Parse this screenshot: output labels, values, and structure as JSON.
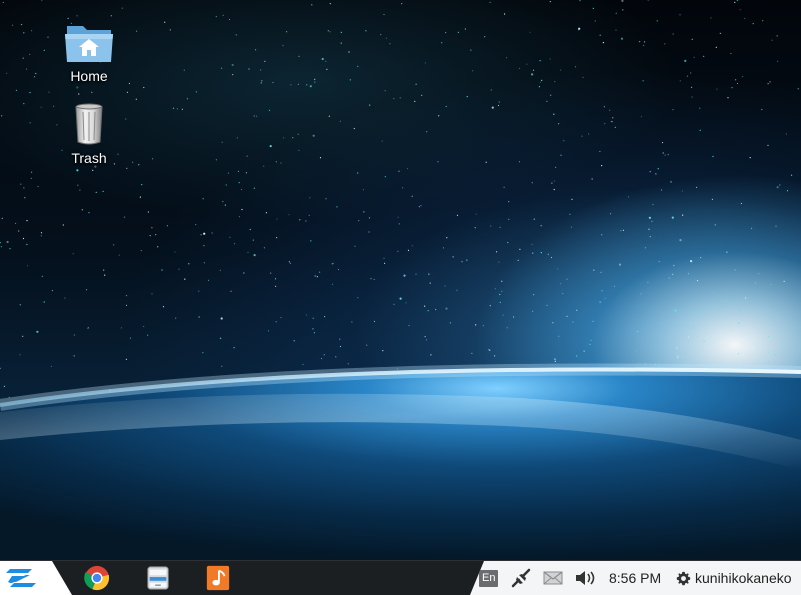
{
  "desktop": {
    "icons": [
      {
        "label": "Home",
        "icon": "home-folder-icon"
      },
      {
        "label": "Trash",
        "icon": "trash-icon"
      }
    ]
  },
  "taskbar": {
    "start_icon": "zorin-logo-icon",
    "launchers": [
      {
        "icon": "chrome-icon",
        "app": "Google Chrome"
      },
      {
        "icon": "file-manager-icon",
        "app": "Files"
      },
      {
        "icon": "music-player-icon",
        "app": "Music"
      }
    ],
    "tray": {
      "language": "En",
      "network_icon": "network-disconnected-icon",
      "mail_icon": "mail-icon",
      "volume_icon": "volume-icon",
      "clock": "8:56 PM",
      "username": "kunihikokaneko",
      "user_icon": "gear-icon"
    }
  },
  "colors": {
    "taskbar_bg": "#1c1f22",
    "tray_bg": "#f4f5f6",
    "accent": "#1c8de0"
  }
}
